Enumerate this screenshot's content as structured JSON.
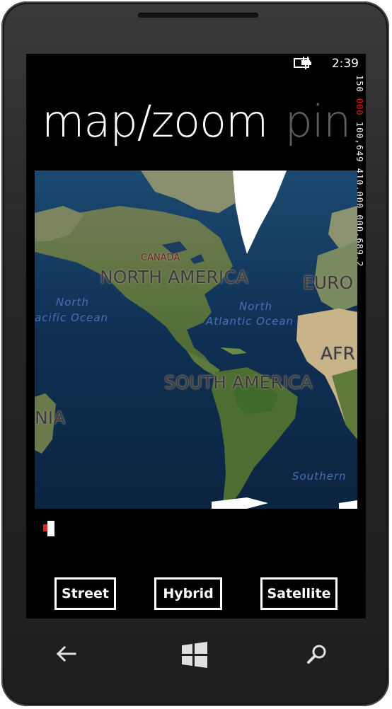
{
  "status_bar": {
    "time": "2:39",
    "battery_icon": "battery-charging-icon"
  },
  "pivot": {
    "current_title": "map/zoom",
    "next_title": "pin"
  },
  "fps_counter": {
    "text_white_1": "150",
    "text_red": "000",
    "text_white_2": "100,649 410,000 000,689.2"
  },
  "map": {
    "style": "Satellite",
    "labels": {
      "canada": "CANADA",
      "north_america": "NORTH AMERICA",
      "europe": "EURO",
      "africa": "AFR",
      "south_america": "SOUTH AMERICA",
      "asia_partial": "NIA",
      "north_pacific_1": "North",
      "north_pacific_2": "acific Ocean",
      "north_atlantic_1": "North",
      "north_atlantic_2": "Atlantic Ocean",
      "southern": "Southern"
    }
  },
  "zoom_slider": {
    "value_fraction": 0.08
  },
  "buttons": {
    "street": "Street",
    "hybrid": "Hybrid",
    "satellite": "Satellite"
  },
  "hardware_keys": {
    "back": "back-arrow-icon",
    "start": "windows-logo-icon",
    "search": "search-icon"
  },
  "colors": {
    "accent": "#e0251e",
    "screen_bg": "#000000",
    "ocean": "#0d2a48"
  }
}
